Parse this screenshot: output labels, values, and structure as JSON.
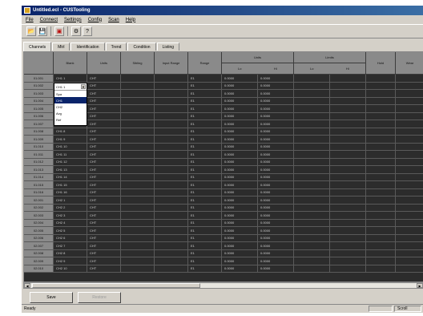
{
  "window": {
    "title": "Untitled.ecl - CUSTooling"
  },
  "menu": [
    "File",
    "Connect",
    "Settings",
    "Config",
    "Scan",
    "Help"
  ],
  "toolbar": {
    "icons": [
      "open-icon",
      "save-icon",
      "print-icon",
      "settings-icon",
      "help-icon"
    ]
  },
  "tabs": [
    "Channels",
    "Mtrl",
    "Identification",
    "Trend",
    "Condition",
    "Listing"
  ],
  "active_tab": 0,
  "columns": [
    "Blank",
    "Units",
    "Sibling",
    "Input Range",
    "Range",
    "Units",
    "Limits",
    "Hold",
    "Wear"
  ],
  "sub_columns": [
    "Lo",
    "Hi",
    "Lo",
    "Hi"
  ],
  "rows": [
    {
      "id": "01.001",
      "name": "CH1 1",
      "units": "CHT",
      "range": "E1",
      "lo": "0.0000",
      "hi": "0.0000"
    },
    {
      "id": "01.002",
      "name": "CH1 2",
      "units": "CHT",
      "range": "E1",
      "lo": "0.0000",
      "hi": "0.0000"
    },
    {
      "id": "01.003",
      "name": "CH1 3",
      "units": "CHT",
      "range": "E1",
      "lo": "0.0000",
      "hi": "0.0000"
    },
    {
      "id": "01.004",
      "name": "CH1 4",
      "units": "CHT",
      "range": "E1",
      "lo": "0.0000",
      "hi": "0.0000"
    },
    {
      "id": "01.005",
      "name": "CH1 5",
      "units": "CHT",
      "range": "E1",
      "lo": "0.0000",
      "hi": "0.0000"
    },
    {
      "id": "01.006",
      "name": "CH1 6",
      "units": "CHT",
      "range": "E1",
      "lo": "0.0000",
      "hi": "0.0000"
    },
    {
      "id": "01.007",
      "name": "CH1 7",
      "units": "CHT",
      "range": "E1",
      "lo": "0.0000",
      "hi": "0.0000"
    },
    {
      "id": "01.008",
      "name": "CH1 8",
      "units": "CHT",
      "range": "E1",
      "lo": "0.0000",
      "hi": "0.0000"
    },
    {
      "id": "01.009",
      "name": "CH1 9",
      "units": "CHT",
      "range": "E1",
      "lo": "0.0000",
      "hi": "0.0000"
    },
    {
      "id": "01.010",
      "name": "CH1 10",
      "units": "CHT",
      "range": "E1",
      "lo": "0.0000",
      "hi": "0.0000"
    },
    {
      "id": "01.011",
      "name": "CH1 11",
      "units": "CHT",
      "range": "E1",
      "lo": "0.0000",
      "hi": "0.0000"
    },
    {
      "id": "01.012",
      "name": "CH1 12",
      "units": "CHT",
      "range": "E1",
      "lo": "0.0000",
      "hi": "0.0000"
    },
    {
      "id": "01.013",
      "name": "CH1 13",
      "units": "CHT",
      "range": "E1",
      "lo": "0.0000",
      "hi": "0.0000"
    },
    {
      "id": "01.014",
      "name": "CH1 14",
      "units": "CHT",
      "range": "E1",
      "lo": "0.0000",
      "hi": "0.0000"
    },
    {
      "id": "01.015",
      "name": "CH1 15",
      "units": "CHT",
      "range": "E1",
      "lo": "0.0000",
      "hi": "0.0000"
    },
    {
      "id": "01.016",
      "name": "CH1 16",
      "units": "CHT",
      "range": "E1",
      "lo": "0.0000",
      "hi": "0.0000"
    },
    {
      "id": "02.001",
      "name": "CH2 1",
      "units": "CHT",
      "range": "E1",
      "lo": "0.0000",
      "hi": "0.0000"
    },
    {
      "id": "02.002",
      "name": "CH2 2",
      "units": "CHT",
      "range": "E1",
      "lo": "0.0000",
      "hi": "0.0000"
    },
    {
      "id": "02.003",
      "name": "CH2 3",
      "units": "CHT",
      "range": "E1",
      "lo": "0.0000",
      "hi": "0.0000"
    },
    {
      "id": "02.004",
      "name": "CH2 4",
      "units": "CHT",
      "range": "E1",
      "lo": "0.0000",
      "hi": "0.0000"
    },
    {
      "id": "02.005",
      "name": "CH2 5",
      "units": "CHT",
      "range": "E1",
      "lo": "0.0000",
      "hi": "0.0000"
    },
    {
      "id": "02.006",
      "name": "CH2 6",
      "units": "CHT",
      "range": "E1",
      "lo": "0.0000",
      "hi": "0.0000"
    },
    {
      "id": "02.007",
      "name": "CH2 7",
      "units": "CHT",
      "range": "E1",
      "lo": "0.0000",
      "hi": "0.0000"
    },
    {
      "id": "02.008",
      "name": "CH2 8",
      "units": "CHT",
      "range": "E1",
      "lo": "0.0000",
      "hi": "0.0000"
    },
    {
      "id": "02.009",
      "name": "CH2 9",
      "units": "CHT",
      "range": "E1",
      "lo": "0.0000",
      "hi": "0.0000"
    },
    {
      "id": "02.010",
      "name": "CH2 10",
      "units": "CHT",
      "range": "E1",
      "lo": "0.0000",
      "hi": "0.0000"
    }
  ],
  "dropdown": {
    "value": "CH1 1",
    "options": [
      "Spa",
      "CH1",
      "CH2",
      "Avg",
      "Ref"
    ],
    "selected": 1
  },
  "buttons": {
    "save": "Save",
    "restore": "Restore"
  },
  "status": {
    "text": "Ready",
    "num": "Scroll"
  },
  "colors": {
    "grid_bg": "#2c2c2c",
    "header_bg": "#8a8a8a",
    "title_bg": "#0a246a",
    "dialog_bg": "#d4d0c8"
  }
}
